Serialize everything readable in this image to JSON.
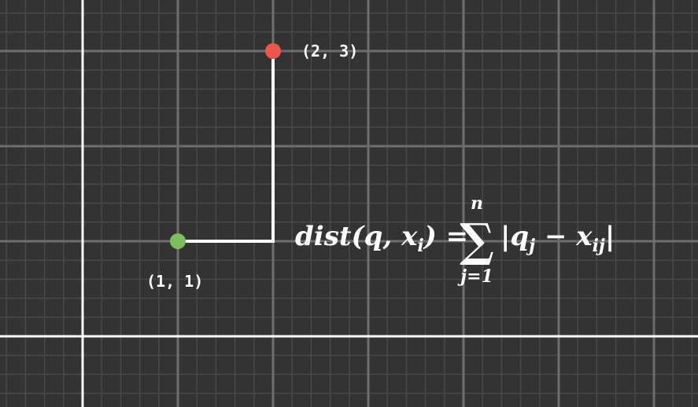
{
  "colors": {
    "background": "#333333",
    "grid_minor": "#4a4a4a",
    "grid_major": "#6e6e6e",
    "axis": "#ffffff",
    "path": "#ffffff",
    "point_start": "#7dbf5e",
    "point_end": "#f0554c",
    "text": "#ffffff"
  },
  "points": [
    {
      "id": "start",
      "x": 1,
      "y": 1,
      "label": "(1, 1)",
      "color": "#7dbf5e"
    },
    {
      "id": "end",
      "x": 2,
      "y": 3,
      "label": "(2, 3)",
      "color": "#f0554c"
    }
  ],
  "formula": {
    "lhs": "dist(q, x",
    "lhs_sub": "i",
    "lhs_close": ") =",
    "sum_symbol": "∑",
    "sum_upper": "n",
    "sum_lower": "j=1",
    "abs_open": "|q",
    "abs_q_sub": "j",
    "minus": " − x",
    "abs_x_sub": "ij",
    "abs_close": "|"
  }
}
